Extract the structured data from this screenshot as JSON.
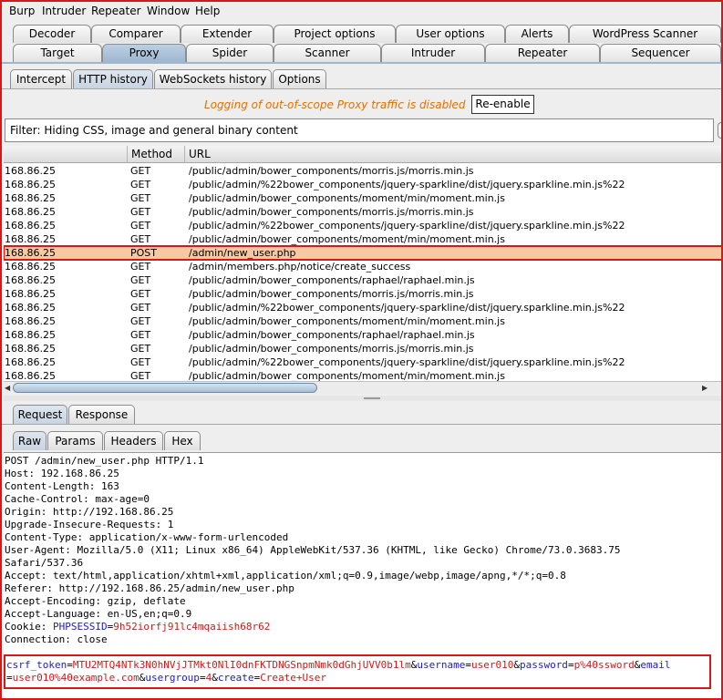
{
  "menu": [
    "Burp",
    "Intruder",
    "Repeater",
    "Window",
    "Help"
  ],
  "tabs_row1": [
    "Decoder",
    "Comparer",
    "Extender",
    "Project options",
    "User options",
    "Alerts",
    "WordPress Scanner"
  ],
  "tabs_row2": [
    "Target",
    "Proxy",
    "Spider",
    "Scanner",
    "Intruder",
    "Repeater",
    "Sequencer"
  ],
  "active_tab": "Proxy",
  "proxy_tabs": [
    "Intercept",
    "HTTP history",
    "WebSockets history",
    "Options"
  ],
  "active_proxy_tab": "HTTP history",
  "logging_notice": "Logging of out-of-scope Proxy traffic is disabled",
  "reenable_label": "Re-enable",
  "filter_text": "Filter: Hiding CSS, image and general binary content",
  "table": {
    "columns": [
      "",
      "Method",
      "URL"
    ],
    "rows": [
      {
        "host": "168.86.25",
        "method": "GET",
        "url": "/public/admin/bower_components/morris.js/morris.min.js"
      },
      {
        "host": "168.86.25",
        "method": "GET",
        "url": "/public/admin/%22bower_components/jquery-sparkline/dist/jquery.sparkline.min.js%22"
      },
      {
        "host": "168.86.25",
        "method": "GET",
        "url": "/public/admin/bower_components/moment/min/moment.min.js"
      },
      {
        "host": "168.86.25",
        "method": "GET",
        "url": "/public/admin/bower_components/morris.js/morris.min.js"
      },
      {
        "host": "168.86.25",
        "method": "GET",
        "url": "/public/admin/%22bower_components/jquery-sparkline/dist/jquery.sparkline.min.js%22"
      },
      {
        "host": "168.86.25",
        "method": "GET",
        "url": "/public/admin/bower_components/moment/min/moment.min.js"
      },
      {
        "host": "168.86.25",
        "method": "POST",
        "url": "/admin/new_user.php",
        "selected": true
      },
      {
        "host": "168.86.25",
        "method": "GET",
        "url": "/admin/members.php/notice/create_success"
      },
      {
        "host": "168.86.25",
        "method": "GET",
        "url": "/public/admin/bower_components/raphael/raphael.min.js"
      },
      {
        "host": "168.86.25",
        "method": "GET",
        "url": "/public/admin/bower_components/morris.js/morris.min.js"
      },
      {
        "host": "168.86.25",
        "method": "GET",
        "url": "/public/admin/%22bower_components/jquery-sparkline/dist/jquery.sparkline.min.js%22"
      },
      {
        "host": "168.86.25",
        "method": "GET",
        "url": "/public/admin/bower_components/moment/min/moment.min.js"
      },
      {
        "host": "168.86.25",
        "method": "GET",
        "url": "/public/admin/bower_components/raphael/raphael.min.js"
      },
      {
        "host": "168.86.25",
        "method": "GET",
        "url": "/public/admin/bower_components/morris.js/morris.min.js"
      },
      {
        "host": "168.86.25",
        "method": "GET",
        "url": "/public/admin/%22bower_components/jquery-sparkline/dist/jquery.sparkline.min.js%22"
      },
      {
        "host": "168.86.25",
        "method": "GET",
        "url": "/public/admin/bower_components/moment/min/moment.min.js"
      }
    ]
  },
  "msg_tabs": [
    "Request",
    "Response"
  ],
  "active_msg_tab": "Request",
  "view_tabs": [
    "Raw",
    "Params",
    "Headers",
    "Hex"
  ],
  "active_view_tab": "Raw",
  "request_lines": [
    "POST /admin/new_user.php HTTP/1.1",
    "Host: 192.168.86.25",
    "Content-Length: 163",
    "Cache-Control: max-age=0",
    "Origin: http://192.168.86.25",
    "Upgrade-Insecure-Requests: 1",
    "Content-Type: application/x-www-form-urlencoded",
    "User-Agent: Mozilla/5.0 (X11; Linux x86_64) AppleWebKit/537.36 (KHTML, like Gecko) Chrome/73.0.3683.75",
    "Safari/537.36",
    "Accept: text/html,application/xhtml+xml,application/xml;q=0.9,image/webp,image/apng,*/*;q=0.8",
    "Referer: http://192.168.86.25/admin/new_user.php",
    "Accept-Encoding: gzip, deflate",
    "Accept-Language: en-US,en;q=0.9"
  ],
  "cookie": {
    "label": "Cookie: ",
    "name": "PHPSESSID",
    "eq": "=",
    "value": "9h52iorfj91lc4mqaiish68r62"
  },
  "connection_line": "Connection: close",
  "body_line1": [
    {
      "t": "csrf_token",
      "c": "bl"
    },
    {
      "t": "=",
      "c": ""
    },
    {
      "t": "MTU2MTQ4NTk3N0hNVjJTMkt0NlI0dnFKTDNGSnpmNmk0dGhjUVV0b1lm",
      "c": "rd"
    },
    {
      "t": "&",
      "c": ""
    },
    {
      "t": "username",
      "c": "bl"
    },
    {
      "t": "=",
      "c": ""
    },
    {
      "t": "user010",
      "c": "rd"
    },
    {
      "t": "&",
      "c": ""
    },
    {
      "t": "password",
      "c": "bl"
    },
    {
      "t": "=",
      "c": ""
    },
    {
      "t": "p%40ssword",
      "c": "rd"
    },
    {
      "t": "&",
      "c": ""
    },
    {
      "t": "email",
      "c": "bl"
    }
  ],
  "body_line2": [
    {
      "t": "=",
      "c": ""
    },
    {
      "t": "user010%40example.com",
      "c": "rd"
    },
    {
      "t": "&",
      "c": ""
    },
    {
      "t": "usergroup",
      "c": "bl"
    },
    {
      "t": "=",
      "c": ""
    },
    {
      "t": "4",
      "c": "rd"
    },
    {
      "t": "&",
      "c": ""
    },
    {
      "t": "create",
      "c": "bl"
    },
    {
      "t": "=",
      "c": ""
    },
    {
      "t": "Create+User",
      "c": "rd"
    }
  ]
}
